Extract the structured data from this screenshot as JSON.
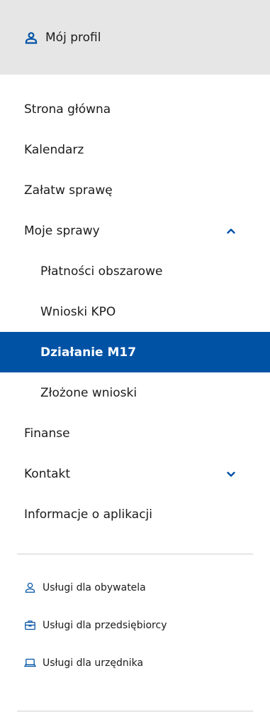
{
  "profile": {
    "label": "Mój profil"
  },
  "menu": {
    "home": "Strona główna",
    "calendar": "Kalendarz",
    "handle_case": "Załatw sprawę",
    "my_cases": "Moje sprawy",
    "area_payments": "Płatności obszarowe",
    "kpo_applications": "Wnioski KPO",
    "measure_m17": "Działanie M17",
    "submitted_applications": "Złożone wnioski",
    "finances": "Finanse",
    "contact": "Kontakt",
    "app_info": "Informacje o aplikacji"
  },
  "footer": {
    "citizen": "Usługi dla obywatela",
    "entrepreneur": "Usługi dla przedsiębiorcy",
    "official": "Usługi dla urzędnika"
  },
  "colors": {
    "accent": "#0052a5",
    "profile_bg": "#e6e6e6"
  }
}
